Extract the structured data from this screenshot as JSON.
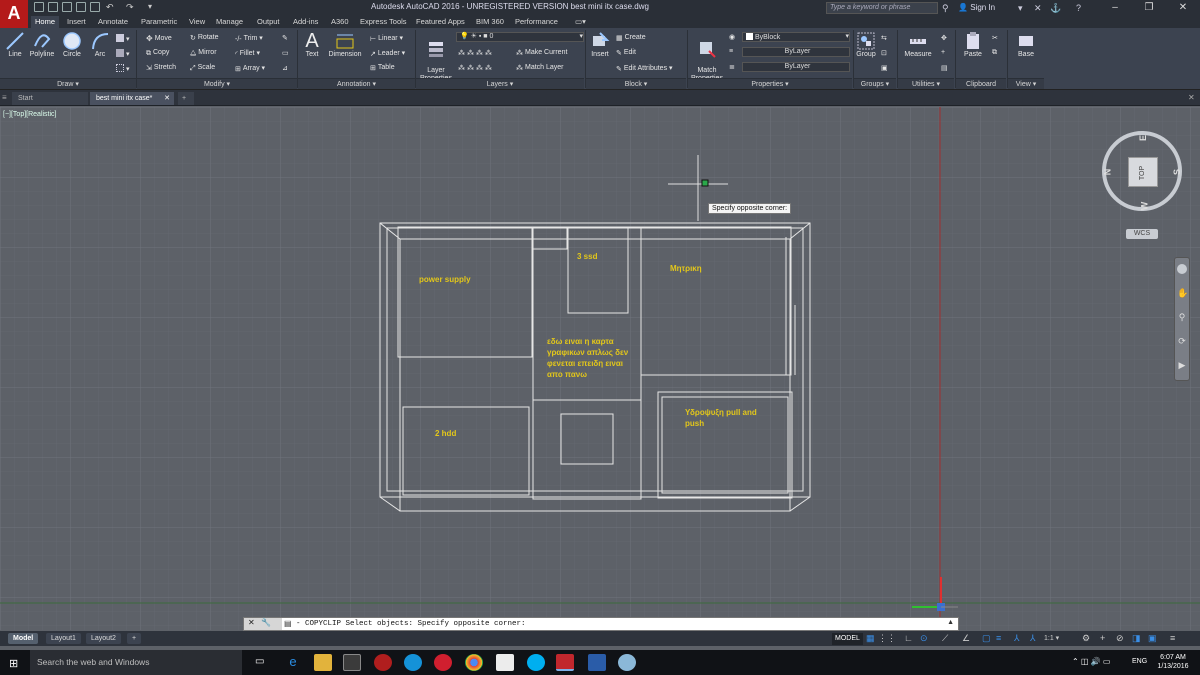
{
  "app": {
    "logo": "A",
    "title": "Autodesk AutoCAD 2016 - UNREGISTERED VERSION    best mini itx case.dwg"
  },
  "search": {
    "placeholder": "Type a keyword or phrase"
  },
  "signin": "Sign In",
  "window_controls": [
    "–",
    "❐",
    "✕"
  ],
  "ribbon_tabs": [
    "Home",
    "Insert",
    "Annotate",
    "Parametric",
    "View",
    "Manage",
    "Output",
    "Add-ins",
    "A360",
    "Express Tools",
    "Featured Apps",
    "BIM 360",
    "Performance"
  ],
  "draw": {
    "line": "Line",
    "polyline": "Polyline",
    "circle": "Circle",
    "arc": "Arc",
    "label": "Draw ▾"
  },
  "modify": {
    "move": "Move",
    "rotate": "Rotate",
    "trim": "Trim ▾",
    "copy": "Copy",
    "mirror": "Mirror",
    "fillet": "Fillet ▾",
    "stretch": "Stretch",
    "scale": "Scale",
    "array": "Array ▾",
    "label": "Modify ▾"
  },
  "annotation": {
    "text": "Text",
    "dimension": "Dimension",
    "linear": "Linear ▾",
    "leader": "Leader ▾",
    "table": "Table",
    "label": "Annotation ▾"
  },
  "layers": {
    "layer_properties": "Layer\nProperties",
    "current_layer": "0",
    "make_current": "Make Current",
    "match_layer": "Match Layer",
    "label": "Layers ▾"
  },
  "block": {
    "insert": "Insert",
    "create": "Create",
    "edit": "Edit",
    "edit_attributes": "Edit Attributes ▾",
    "label": "Block ▾"
  },
  "properties": {
    "match": "Match\nProperties",
    "color": "ByBlock",
    "linetype": "ByLayer",
    "lineweight": "ByLayer",
    "label": "Properties ▾"
  },
  "groups": {
    "group": "Group",
    "label": "Groups ▾"
  },
  "utilities": {
    "measure": "Measure",
    "label": "Utilities ▾"
  },
  "clipboard": {
    "paste": "Paste",
    "label": "Clipboard"
  },
  "view": {
    "base": "Base",
    "label": "View ▾"
  },
  "doc_tabs": [
    "Start",
    "best mini itx case*"
  ],
  "viewport": {
    "label": "[−][Top][Realistic]",
    "tooltip": "Specify opposite corner:"
  },
  "notes": {
    "power_supply": "power supply",
    "ssd": "3 ssd",
    "motherboard": "Μητρικη",
    "gpu": "εδω ειναι η καρτα\nγραφικων απλως δεν\nφενεται επειδη ειναι\nαπο πανω",
    "hdd": "2 hdd",
    "cooling": "Υδροψυξη pull and\npush"
  },
  "viewcube": {
    "n": "N",
    "s": "S",
    "e": "E",
    "w": "W",
    "top": "TOP",
    "wcs": "WCS"
  },
  "command": {
    "prompt": "- COPYCLIP Select objects: Specify opposite corner:"
  },
  "layout_tabs": [
    "Model",
    "Layout1",
    "Layout2"
  ],
  "status": {
    "model": "MODEL",
    "scale": "1:1 ▾"
  },
  "taskbar": {
    "search": "Search the web and Windows",
    "lang": "ENG",
    "time": "6:07 AM",
    "date": "1/13/2016"
  },
  "colors": {
    "accent": "#b41a1a",
    "annotation": "#e3c71a"
  }
}
